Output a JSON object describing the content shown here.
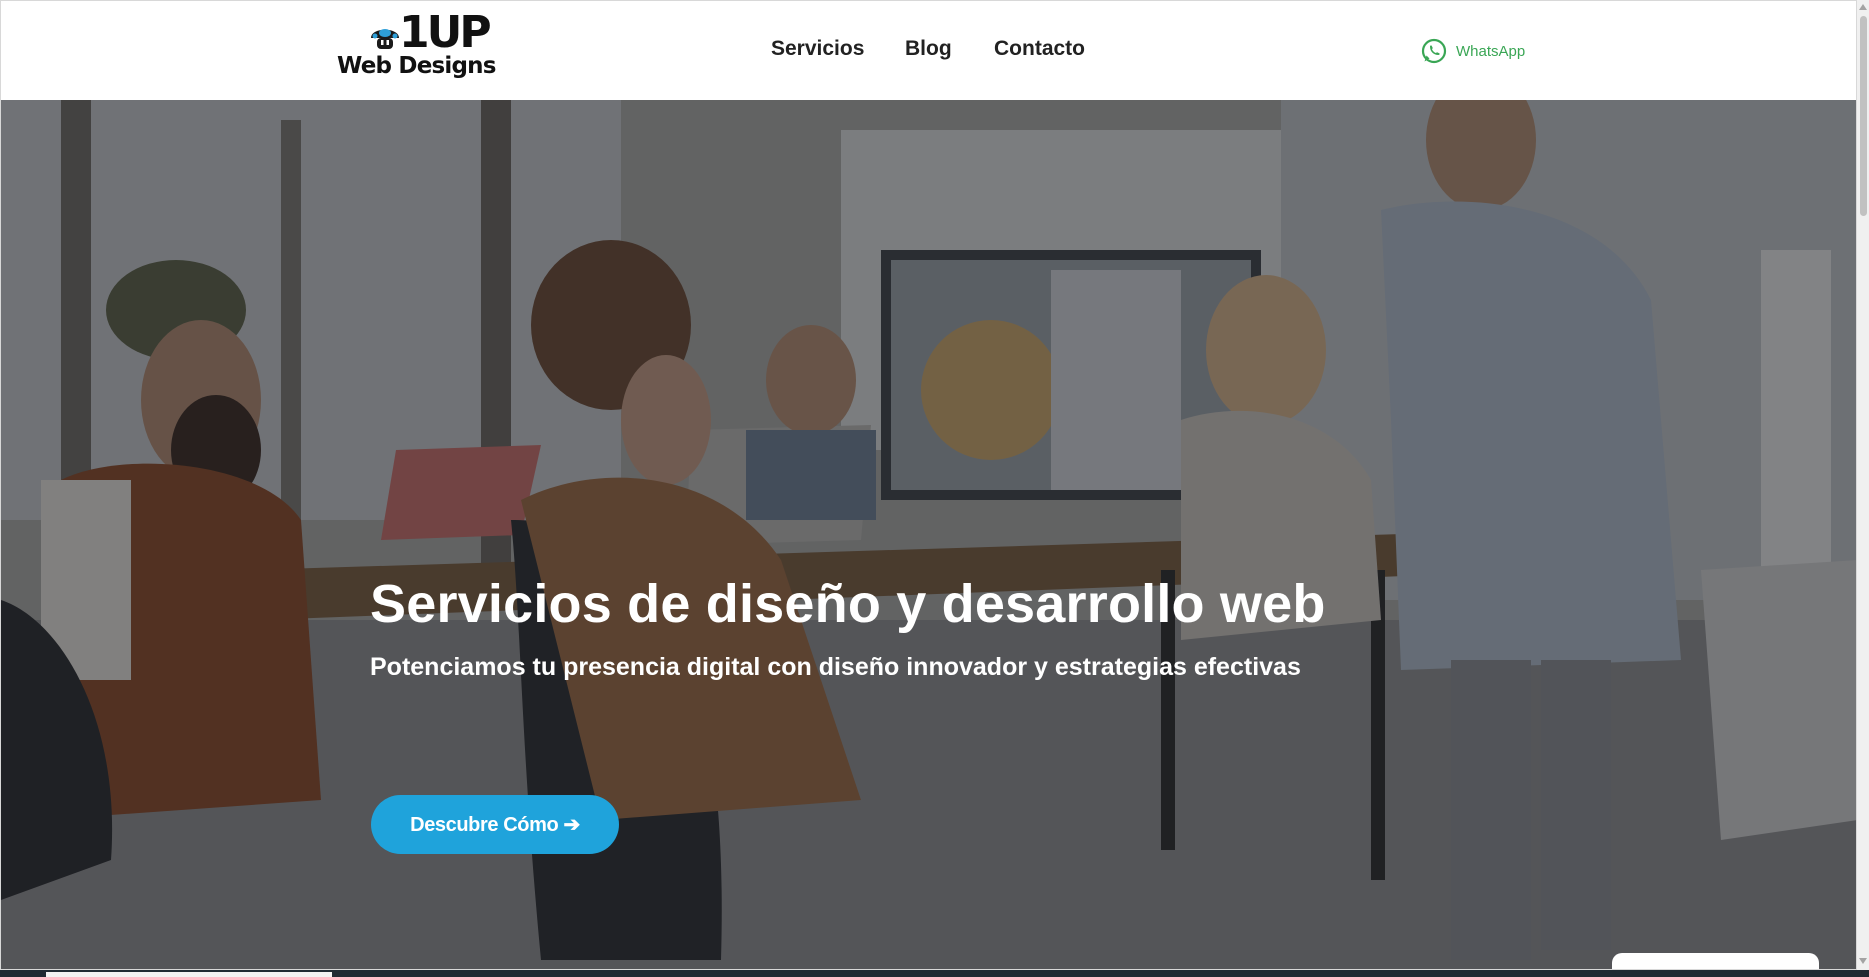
{
  "header": {
    "logo": {
      "top": "1UP",
      "sub": "Web Designs"
    },
    "nav": [
      {
        "label": "Servicios"
      },
      {
        "label": "Blog"
      },
      {
        "label": "Contacto"
      }
    ],
    "whatsapp": {
      "label": "WhatsApp",
      "icon": "whatsapp-icon",
      "color": "#3aa655"
    }
  },
  "hero": {
    "title": "Servicios de diseño y desarrollo web",
    "subtitle": "Potenciamos tu presencia digital con diseño innovador y estrategias efectivas",
    "cta": "Descubre Cómo ➔",
    "cta_color": "#1fa3db"
  }
}
